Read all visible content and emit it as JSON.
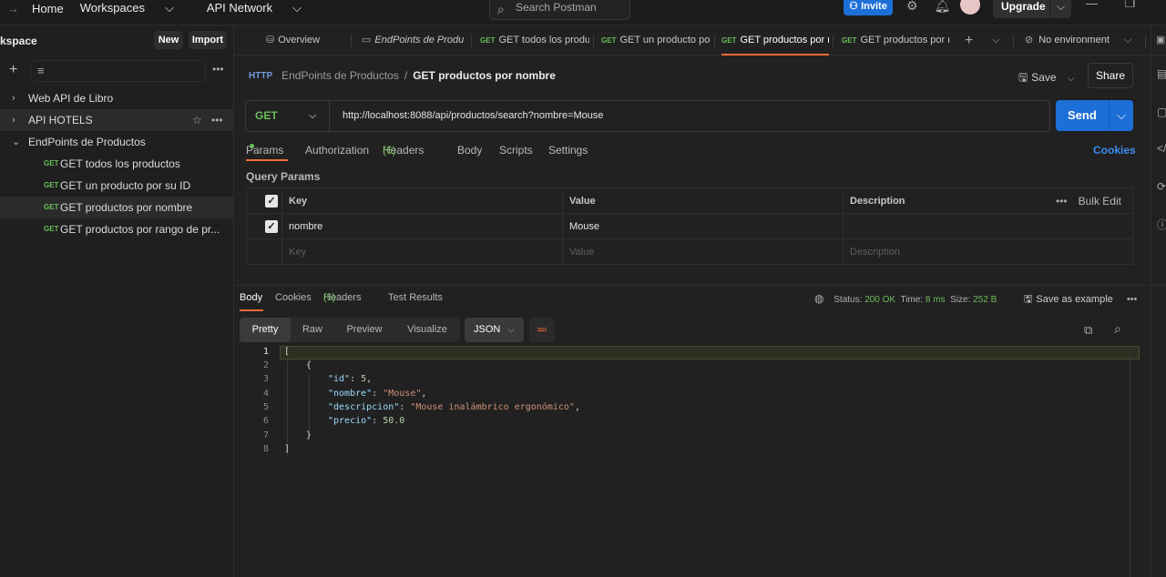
{
  "topbar": {
    "nav": [
      "Home",
      "Workspaces",
      "API Network"
    ],
    "search_placeholder": "Search Postman",
    "invite": "Invite",
    "upgrade": "Upgrade"
  },
  "sidebar": {
    "workspace_title": "kspace",
    "new_label": "New",
    "import_label": "Import",
    "collections": [
      {
        "label": "Web API de Libro"
      },
      {
        "label": "API HOTELS"
      },
      {
        "label": "EndPoints de Productos"
      }
    ],
    "requests": [
      {
        "method": "GET",
        "label": "GET todos los productos"
      },
      {
        "method": "GET",
        "label": "GET un producto por su ID"
      },
      {
        "method": "GET",
        "label": "GET productos por nombre"
      },
      {
        "method": "GET",
        "label": "GET productos por rango de pr..."
      }
    ]
  },
  "tabs": {
    "overview": "Overview",
    "collection": "EndPoints de Produc",
    "items": [
      {
        "method": "GET",
        "label": "GET todos los produ"
      },
      {
        "method": "GET",
        "label": "GET un producto po"
      },
      {
        "method": "GET",
        "label": "GET productos por r"
      },
      {
        "method": "GET",
        "label": "GET productos por r"
      }
    ],
    "environment": "No environment"
  },
  "breadcrumb": {
    "collection": "EndPoints de Productos",
    "separator": "/",
    "request": "GET productos por nombre",
    "save": "Save",
    "share": "Share"
  },
  "request": {
    "method": "GET",
    "url": "http://localhost:8088/api/productos/search?nombre=Mouse",
    "send": "Send",
    "tabs": {
      "params": "Params",
      "authorization": "Authorization",
      "headers": "Headers",
      "headers_count": "(6)",
      "body": "Body",
      "scripts": "Scripts",
      "settings": "Settings"
    },
    "cookies": "Cookies",
    "query_params_title": "Query Params",
    "table": {
      "headers": [
        "Key",
        "Value",
        "Description"
      ],
      "bulk_edit": "Bulk Edit",
      "rows": [
        {
          "key": "nombre",
          "value": "Mouse",
          "description": ""
        }
      ],
      "placeholders": {
        "key": "Key",
        "value": "Value",
        "description": "Description"
      }
    }
  },
  "response": {
    "tabs": {
      "body": "Body",
      "cookies": "Cookies",
      "headers": "Headers",
      "headers_count": "(5)",
      "test_results": "Test Results"
    },
    "status_label": "Status:",
    "status_value": "200 OK",
    "time_label": "Time:",
    "time_value": "8 ms",
    "size_label": "Size:",
    "size_value": "252 B",
    "save_example": "Save as example",
    "view_modes": [
      "Pretty",
      "Raw",
      "Preview",
      "Visualize"
    ],
    "format": "JSON",
    "code": {
      "line_numbers": [
        "1",
        "2",
        "3",
        "4",
        "5",
        "6",
        "7",
        "8"
      ],
      "open_bracket": "[",
      "open_brace": "{",
      "k_id": "\"id\"",
      "v_id": "5",
      "k_nombre": "\"nombre\"",
      "v_nombre": "\"Mouse\"",
      "k_desc": "\"descripcion\"",
      "v_desc": "\"Mouse inalámbrico ergonómico\"",
      "k_precio": "\"precio\"",
      "v_precio": "50.0",
      "close_brace": "}",
      "close_bracket": "]"
    }
  },
  "colors": {
    "accent": "#f26b3a",
    "primary": "#1d6fd8",
    "method_get": "#6bbd5b"
  }
}
